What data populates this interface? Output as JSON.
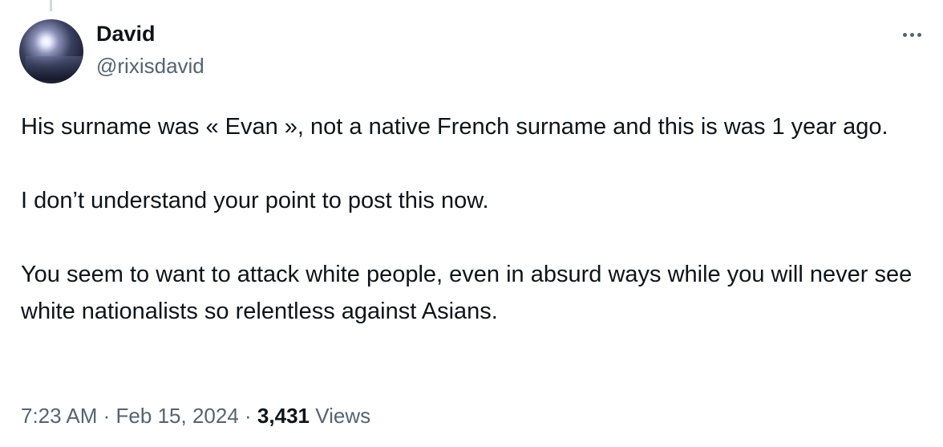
{
  "author": {
    "name": "David",
    "handle": "@rixisdavid"
  },
  "icons": {
    "more": "more-horizontal-icon",
    "avatar": "profile-photo"
  },
  "tweet": {
    "paragraphs": [
      "His surname was « Evan », not a native French surname and this is was 1 year ago.",
      "I don’t understand your point to post this now.",
      "You seem to want to attack white people, even in absurd ways while you will never see white nationalists so relentless against Asians."
    ]
  },
  "meta": {
    "time": "7:23 AM",
    "separator": "·",
    "date": "Feb 15, 2024",
    "views_count": "3,431",
    "views_label": "Views"
  },
  "colors": {
    "text": "#0f1419",
    "secondary": "#536471",
    "thread_line": "#cfd9de"
  }
}
